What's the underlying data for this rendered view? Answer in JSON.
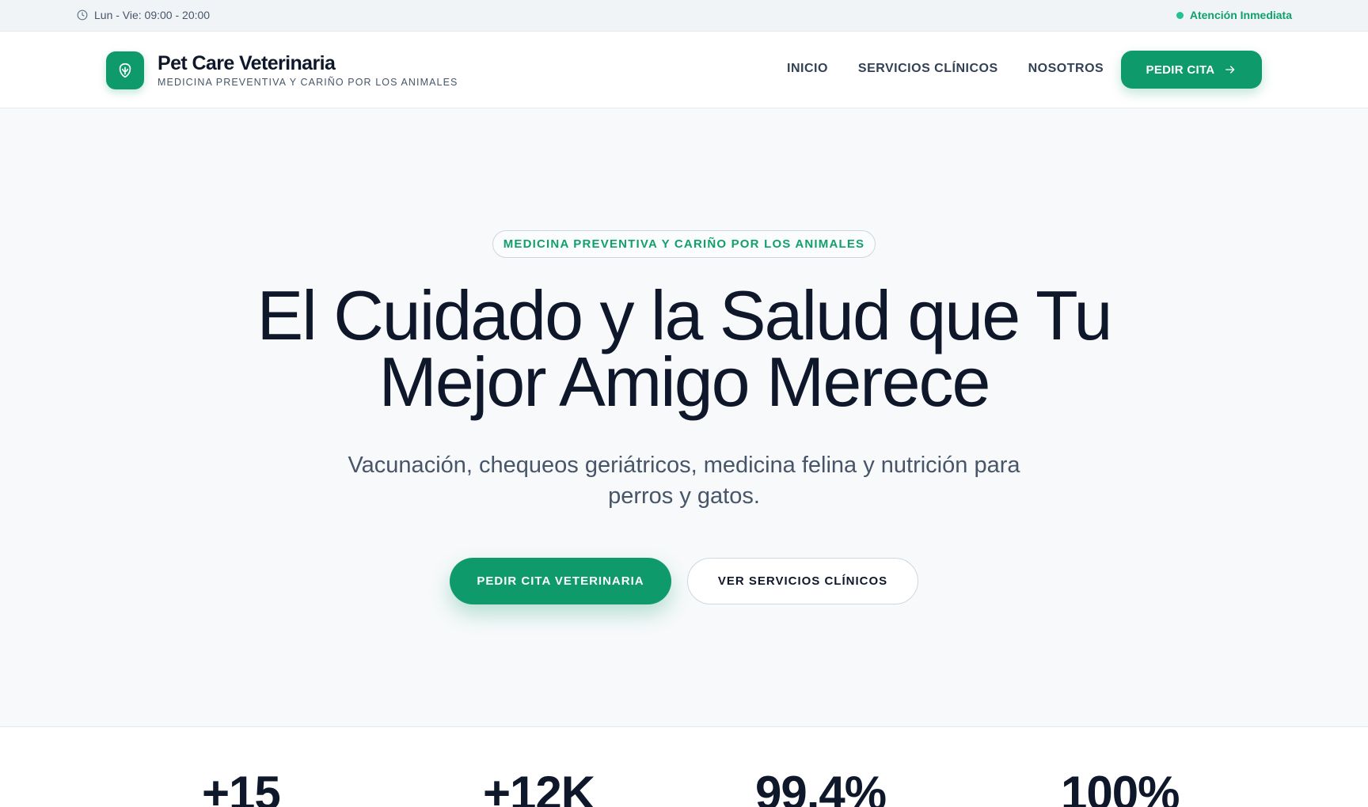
{
  "topbar": {
    "hours": "Lun - Vie: 09:00 - 20:00",
    "status": "Atención Inmediata"
  },
  "header": {
    "brand_name": "Pet Care Veterinaria",
    "brand_tagline": "MEDICINA PREVENTIVA Y CARIÑO POR LOS ANIMALES",
    "nav": [
      "INICIO",
      "SERVICIOS CLÍNICOS",
      "NOSOTROS"
    ],
    "cta": "PEDIR CITA"
  },
  "hero": {
    "badge": "MEDICINA PREVENTIVA Y CARIÑO POR LOS ANIMALES",
    "headline_line1": "El Cuidado y la Salud que Tu",
    "headline_line2": "Mejor Amigo Merece",
    "subtitle_line1": "Vacunación, chequeos geriátricos, medicina felina y nutrición para",
    "subtitle_line2": "perros y gatos.",
    "primary_button": "PEDIR CITA VETERINARIA",
    "secondary_button": "VER SERVICIOS CLÍNICOS"
  },
  "stats": [
    "+15",
    "+12K",
    "99.4%",
    "100%"
  ],
  "colors": {
    "accent": "#0f9a6b",
    "status_dot": "#22c38e",
    "text_dark": "#0f172a"
  }
}
